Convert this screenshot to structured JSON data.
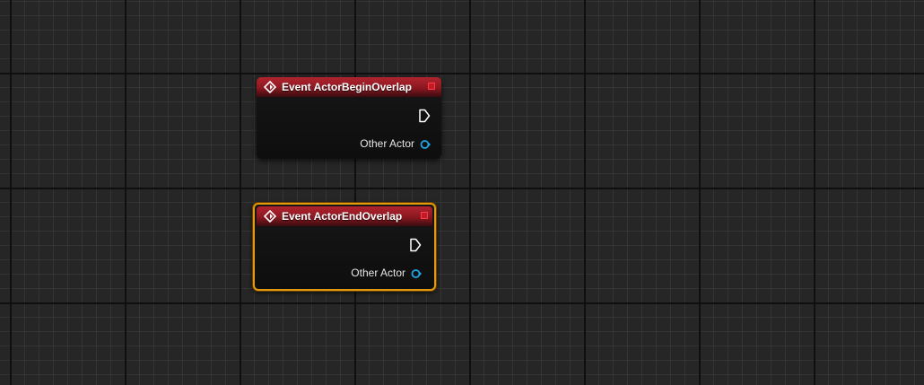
{
  "colors": {
    "event_header": "#b0242f",
    "selection": "#e39a10",
    "object_pin": "#1da5e6",
    "delegate_pin": "#ff3b48"
  },
  "nodes": [
    {
      "title": "Event ActorBeginOverlap",
      "icon": "event-diamond-icon",
      "selected": false,
      "output_pins": [
        {
          "type": "exec",
          "icon": "exec-output-pin-icon"
        },
        {
          "type": "object",
          "label": "Other Actor",
          "icon": "object-pin-icon"
        }
      ]
    },
    {
      "title": "Event ActorEndOverlap",
      "icon": "event-diamond-icon",
      "selected": true,
      "output_pins": [
        {
          "type": "exec",
          "icon": "exec-output-pin-icon"
        },
        {
          "type": "object",
          "label": "Other Actor",
          "icon": "object-pin-icon"
        }
      ]
    }
  ]
}
